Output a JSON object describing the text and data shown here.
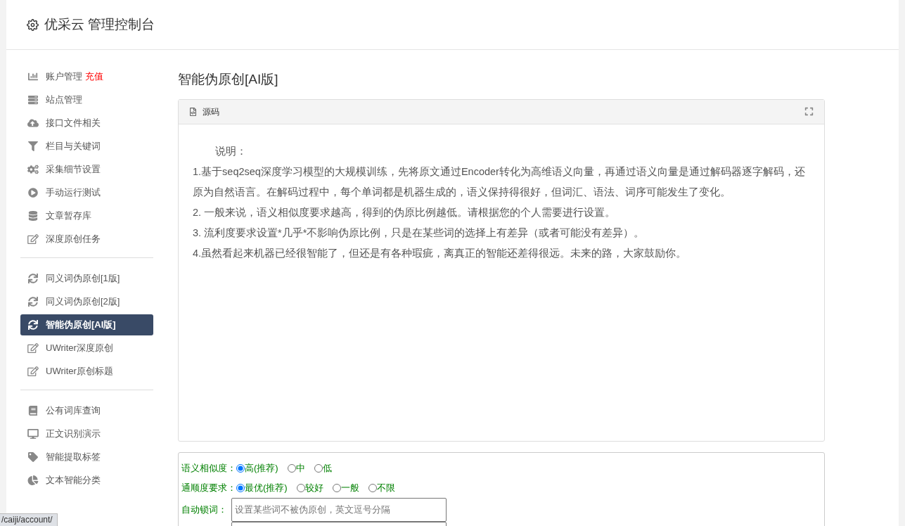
{
  "header": {
    "title": "优采云 管理控制台"
  },
  "sidebar": {
    "groups": [
      {
        "items": [
          {
            "label": "账户管理",
            "badge": "充值",
            "selected": false
          },
          {
            "label": "站点管理",
            "selected": false
          },
          {
            "label": "接口文件相关",
            "selected": false
          },
          {
            "label": "栏目与关键词",
            "selected": false
          },
          {
            "label": "采集细节设置",
            "selected": false
          },
          {
            "label": "手动运行测试",
            "selected": false
          },
          {
            "label": "文章暂存库",
            "selected": false
          },
          {
            "label": "深度原创任务",
            "selected": false
          }
        ]
      },
      {
        "items": [
          {
            "label": "同义词伪原创[1版]",
            "selected": false
          },
          {
            "label": "同义词伪原创[2版]",
            "selected": false
          },
          {
            "label": "智能伪原创[AI版]",
            "selected": true
          },
          {
            "label": "UWriter深度原创",
            "selected": false
          },
          {
            "label": "UWriter原创标题",
            "selected": false
          }
        ]
      },
      {
        "items": [
          {
            "label": "公有词库查询",
            "selected": false
          },
          {
            "label": "正文识别演示",
            "selected": false
          },
          {
            "label": "智能提取标签",
            "selected": false
          },
          {
            "label": "文本智能分类",
            "selected": false
          }
        ]
      }
    ]
  },
  "main": {
    "title": "智能伪原创[AI版]",
    "editor": {
      "tab": "源码",
      "heading": "说明：",
      "paragraphs": [
        "1.基于seq2seq深度学习模型的大规模训练，先将原文通过Encoder转化为高维语义向量，再通过语义向量是通过解码器逐字解码，还原为自然语言。在解码过程中，每个单词都是机器生成的，语义保持得很好，但词汇、语法、词序可能发生了变化。",
        "2. 一般来说，语义相似度要求越高，得到的伪原比例越低。请根据您的个人需要进行设置。",
        "3. 流利度要求设置*几乎*不影响伪原比例，只是在某些词的选择上有差异（或者可能没有差异）。",
        "4.虽然看起来机器已经很智能了，但还是有各种瑕疵，离真正的智能还差得很远。未来的路，大家鼓励你。"
      ]
    },
    "form": [
      {
        "kind": "radio",
        "label": "语义相似度：",
        "options": [
          {
            "label": "高(推荐)",
            "selected": true
          },
          {
            "label": "中",
            "selected": false
          },
          {
            "label": "低",
            "selected": false
          }
        ]
      },
      {
        "kind": "radio",
        "label": "通顺度要求：",
        "options": [
          {
            "label": "最优(推荐)",
            "selected": true
          },
          {
            "label": "较好",
            "selected": false
          },
          {
            "label": "一般",
            "selected": false
          },
          {
            "label": "不限",
            "selected": false
          }
        ]
      },
      {
        "kind": "input",
        "label": "自动锁词：",
        "placeholder": "设置某些词不被伪原创，英文逗号分隔"
      },
      {
        "kind": "input"
      }
    ]
  },
  "status_url": "/caiji/account/"
}
